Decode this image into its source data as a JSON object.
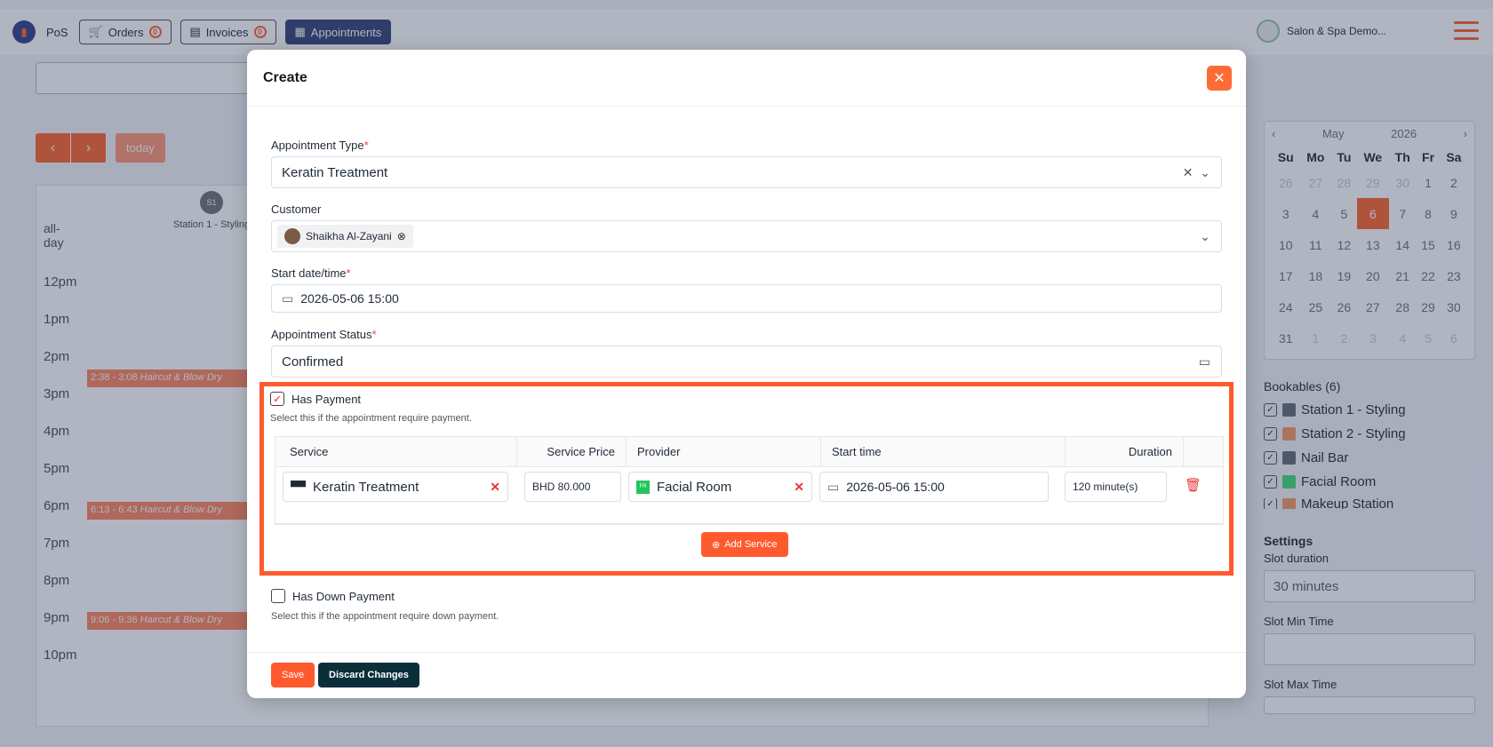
{
  "topbar": {
    "app_label": "PoS",
    "orders_label": "Orders",
    "orders_count": "0",
    "invoices_label": "Invoices",
    "invoices_count": "0",
    "appointments_label": "Appointments",
    "user_name": "Salon & Spa Demo..."
  },
  "calendar": {
    "today_label": "today",
    "station_badge": "S1",
    "station_name": "Station 1 - Styling",
    "allday_label": "all-day",
    "times": [
      "12pm",
      "1pm",
      "2pm",
      "3pm",
      "4pm",
      "5pm",
      "6pm",
      "7pm",
      "8pm",
      "9pm",
      "10pm"
    ],
    "events": [
      {
        "time": "2:38 - 3:08",
        "title": "Haircut & Blow Dry"
      },
      {
        "time": "6:13 - 6:43",
        "title": "Haircut & Blow Dry"
      },
      {
        "time": "9:06 - 9:36",
        "title": "Haircut & Blow Dry"
      }
    ]
  },
  "mini_calendar": {
    "month": "May",
    "year": "2026",
    "weekdays": [
      "Su",
      "Mo",
      "Tu",
      "We",
      "Th",
      "Fr",
      "Sa"
    ],
    "weeks": [
      [
        "26",
        "27",
        "28",
        "29",
        "30",
        "1",
        "2"
      ],
      [
        "3",
        "4",
        "5",
        "6",
        "7",
        "8",
        "9"
      ],
      [
        "10",
        "11",
        "12",
        "13",
        "14",
        "15",
        "16"
      ],
      [
        "17",
        "18",
        "19",
        "20",
        "21",
        "22",
        "23"
      ],
      [
        "24",
        "25",
        "26",
        "27",
        "28",
        "29",
        "30"
      ],
      [
        "31",
        "1",
        "2",
        "3",
        "4",
        "5",
        "6"
      ]
    ],
    "selected": "6"
  },
  "bookables": {
    "title": "Bookables (6)",
    "items": [
      {
        "label": "Station 1 - Styling",
        "color": "#6b7280"
      },
      {
        "label": "Station 2 - Styling",
        "color": "#f59e6b"
      },
      {
        "label": "Nail Bar",
        "color": "#6b7280"
      },
      {
        "label": "Facial Room",
        "color": "#4ade80"
      },
      {
        "label": "Makeup Station",
        "color": "#f59e6b"
      }
    ]
  },
  "settings": {
    "title": "Settings",
    "slot_duration_label": "Slot duration",
    "slot_duration_value": "30 minutes",
    "slot_min_label": "Slot Min Time",
    "slot_max_label": "Slot Max Time"
  },
  "modal": {
    "title": "Create",
    "appointment_type_label": "Appointment Type",
    "appointment_type_value": "Keratin Treatment",
    "customer_label": "Customer",
    "customer_value": "Shaikha Al-Zayani",
    "start_label": "Start date/time",
    "start_value": "2026-05-06 15:00",
    "status_label": "Appointment Status",
    "status_value": "Confirmed",
    "has_payment_label": "Has Payment",
    "has_payment_hint": "Select this if the appointment require payment.",
    "table_headers": {
      "service": "Service",
      "price": "Service Price",
      "provider": "Provider",
      "start_time": "Start time",
      "duration": "Duration"
    },
    "row": {
      "service": "Keratin Treatment",
      "price": "BHD 80.000",
      "provider": "Facial Room",
      "provider_badge": "FR",
      "start_time": "2026-05-06 15:00",
      "duration": "120 minute(s)"
    },
    "add_service_label": "Add Service",
    "has_down_payment_label": "Has Down Payment",
    "has_down_payment_hint": "Select this if the appointment require down payment.",
    "save_label": "Save",
    "discard_label": "Discard Changes"
  }
}
